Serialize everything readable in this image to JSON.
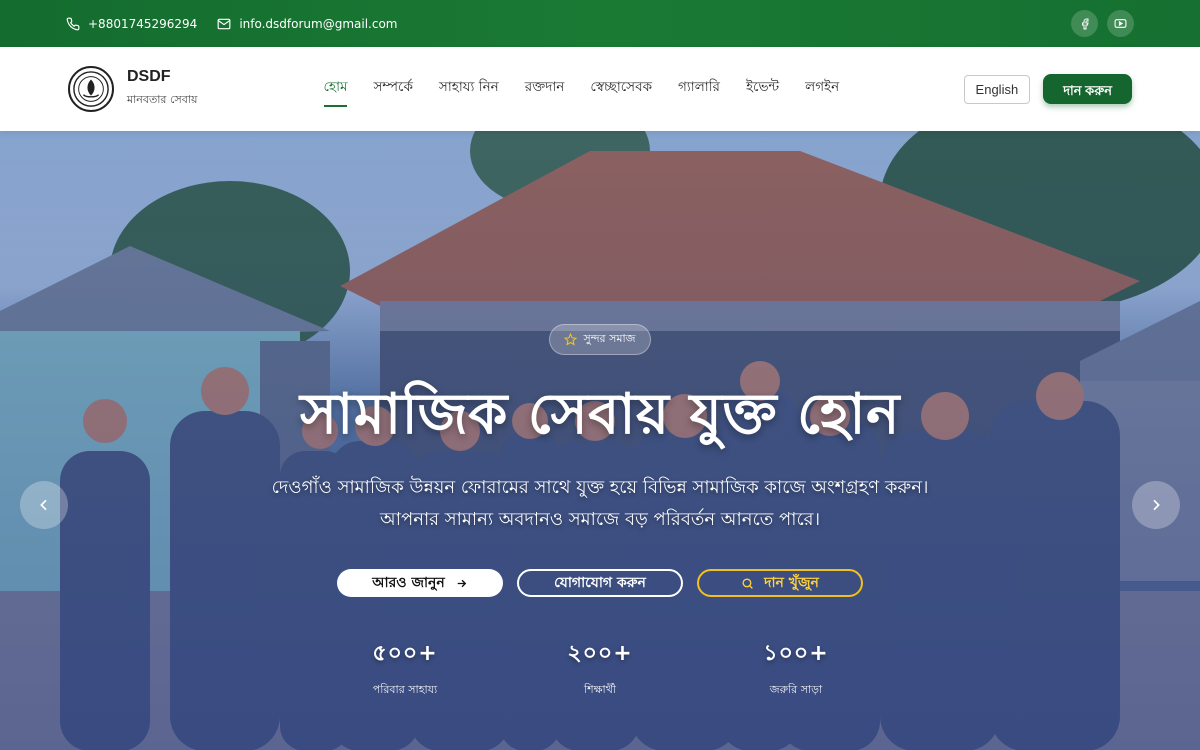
{
  "topbar": {
    "phone": "+8801745296294",
    "email": "info.dsdforum@gmail.com",
    "socials": [
      "facebook-icon",
      "youtube-icon"
    ]
  },
  "header": {
    "brand_name": "DSDF",
    "brand_tagline": "মানবতার সেবায়",
    "nav": [
      {
        "label": "হোম",
        "active": true
      },
      {
        "label": "সম্পর্কে"
      },
      {
        "label": "সাহায্য নিন"
      },
      {
        "label": "রক্তদান"
      },
      {
        "label": "স্বেচ্ছাসেবক"
      },
      {
        "label": "গ্যালারি"
      },
      {
        "label": "ইভেন্ট"
      },
      {
        "label": "লগইন"
      }
    ],
    "language_button": "English",
    "donate_button": "দান করুন"
  },
  "hero": {
    "badge": "সুন্দর সমাজ",
    "title": "সামাজিক সেবায় যুক্ত হোন",
    "subtitle_line1": "দেওগাঁও সামাজিক উন্নয়ন ফোরামের সাথে যুক্ত হয়ে বিভিন্ন সামাজিক কাজে অংশগ্রহণ করুন।",
    "subtitle_line2": "আপনার সামান্য অবদানও সমাজে বড় পরিবর্তন আনতে পারে।",
    "buttons": {
      "learn_more": "আরও জানুন",
      "contact": "যোগাযোগ করুন",
      "find_donation": "দান খুঁজুন"
    },
    "stats": [
      {
        "value": "৫০০+",
        "label": "পরিবার সাহায্য"
      },
      {
        "value": "২০০+",
        "label": "শিক্ষার্থী"
      },
      {
        "value": "১০০+",
        "label": "জরুরি সাড়া"
      }
    ]
  },
  "colors": {
    "brand_green": "#14652e",
    "accent_yellow": "#f2c01e"
  }
}
